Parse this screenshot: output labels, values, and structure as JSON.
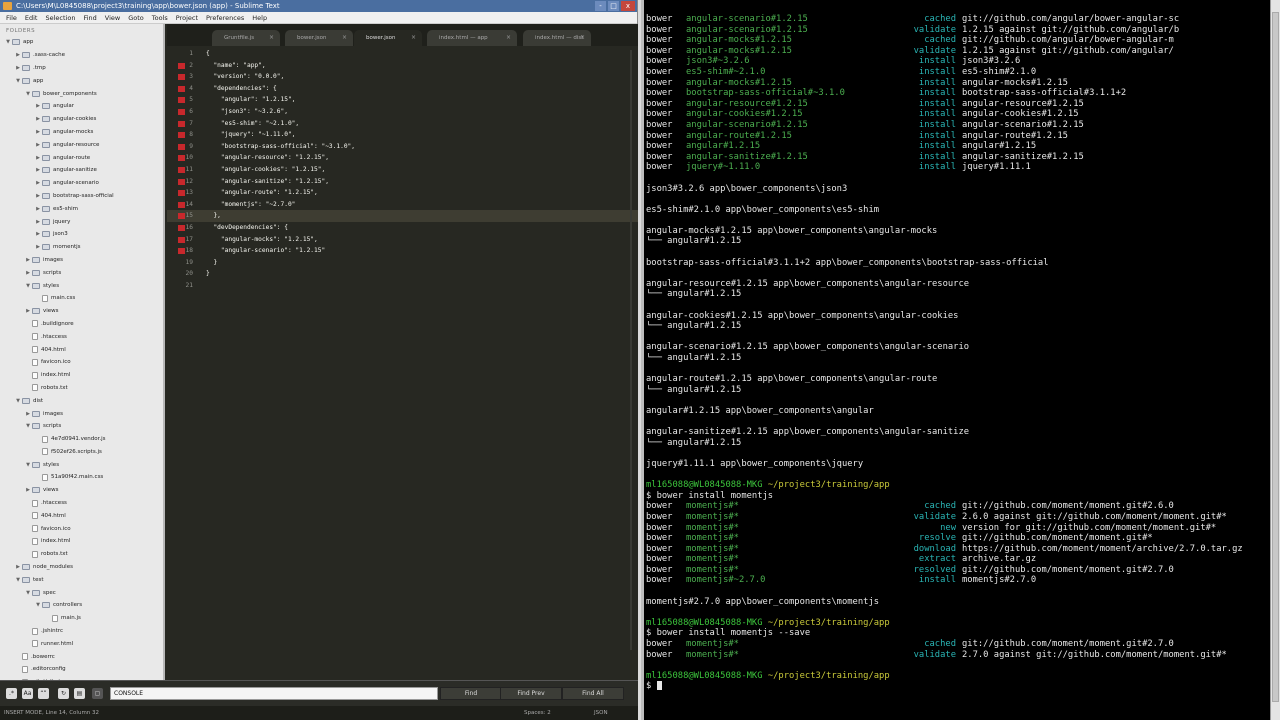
{
  "sublime": {
    "title": "C:\\Users\\M\\L0845088\\project3\\training\\app\\bower.json (app) - Sublime Text",
    "window_controls": [
      "-",
      "□",
      "x"
    ],
    "menu": [
      "File",
      "Edit",
      "Selection",
      "Find",
      "View",
      "Goto",
      "Tools",
      "Project",
      "Preferences",
      "Help"
    ],
    "sidebar_header": "FOLDERS",
    "tree": [
      {
        "label": "app",
        "depth": 0,
        "kind": "folder",
        "open": true
      },
      {
        "label": ".sass-cache",
        "depth": 1,
        "kind": "folder",
        "open": false
      },
      {
        "label": ".tmp",
        "depth": 1,
        "kind": "folder",
        "open": false
      },
      {
        "label": "app",
        "depth": 1,
        "kind": "folder",
        "open": true
      },
      {
        "label": "bower_components",
        "depth": 2,
        "kind": "folder",
        "open": true
      },
      {
        "label": "angular",
        "depth": 3,
        "kind": "folder",
        "open": false
      },
      {
        "label": "angular-cookies",
        "depth": 3,
        "kind": "folder",
        "open": false
      },
      {
        "label": "angular-mocks",
        "depth": 3,
        "kind": "folder",
        "open": false
      },
      {
        "label": "angular-resource",
        "depth": 3,
        "kind": "folder",
        "open": false
      },
      {
        "label": "angular-route",
        "depth": 3,
        "kind": "folder",
        "open": false
      },
      {
        "label": "angular-sanitize",
        "depth": 3,
        "kind": "folder",
        "open": false
      },
      {
        "label": "angular-scenario",
        "depth": 3,
        "kind": "folder",
        "open": false
      },
      {
        "label": "bootstrap-sass-official",
        "depth": 3,
        "kind": "folder",
        "open": false
      },
      {
        "label": "es5-shim",
        "depth": 3,
        "kind": "folder",
        "open": false
      },
      {
        "label": "jquery",
        "depth": 3,
        "kind": "folder",
        "open": false
      },
      {
        "label": "json3",
        "depth": 3,
        "kind": "folder",
        "open": false
      },
      {
        "label": "momentjs",
        "depth": 3,
        "kind": "folder",
        "open": false
      },
      {
        "label": "images",
        "depth": 2,
        "kind": "folder",
        "open": false
      },
      {
        "label": "scripts",
        "depth": 2,
        "kind": "folder",
        "open": false
      },
      {
        "label": "styles",
        "depth": 2,
        "kind": "folder",
        "open": true
      },
      {
        "label": "main.css",
        "depth": 3,
        "kind": "file"
      },
      {
        "label": "views",
        "depth": 2,
        "kind": "folder",
        "open": false
      },
      {
        "label": ".buildignore",
        "depth": 2,
        "kind": "file"
      },
      {
        "label": ".htaccess",
        "depth": 2,
        "kind": "file"
      },
      {
        "label": "404.html",
        "depth": 2,
        "kind": "file"
      },
      {
        "label": "favicon.ico",
        "depth": 2,
        "kind": "file"
      },
      {
        "label": "index.html",
        "depth": 2,
        "kind": "file"
      },
      {
        "label": "robots.txt",
        "depth": 2,
        "kind": "file"
      },
      {
        "label": "dist",
        "depth": 1,
        "kind": "folder",
        "open": true
      },
      {
        "label": "images",
        "depth": 2,
        "kind": "folder",
        "open": false
      },
      {
        "label": "scripts",
        "depth": 2,
        "kind": "folder",
        "open": true
      },
      {
        "label": "4e7d0941.vendor.js",
        "depth": 3,
        "kind": "file"
      },
      {
        "label": "f502ef26.scripts.js",
        "depth": 3,
        "kind": "file"
      },
      {
        "label": "styles",
        "depth": 2,
        "kind": "folder",
        "open": true
      },
      {
        "label": "51a90f42.main.css",
        "depth": 3,
        "kind": "file"
      },
      {
        "label": "views",
        "depth": 2,
        "kind": "folder",
        "open": false
      },
      {
        "label": ".htaccess",
        "depth": 2,
        "kind": "file"
      },
      {
        "label": "404.html",
        "depth": 2,
        "kind": "file"
      },
      {
        "label": "favicon.ico",
        "depth": 2,
        "kind": "file"
      },
      {
        "label": "index.html",
        "depth": 2,
        "kind": "file"
      },
      {
        "label": "robots.txt",
        "depth": 2,
        "kind": "file"
      },
      {
        "label": "node_modules",
        "depth": 1,
        "kind": "folder",
        "open": false
      },
      {
        "label": "test",
        "depth": 1,
        "kind": "folder",
        "open": true
      },
      {
        "label": "spec",
        "depth": 2,
        "kind": "folder",
        "open": true
      },
      {
        "label": "controllers",
        "depth": 3,
        "kind": "folder",
        "open": true
      },
      {
        "label": "main.js",
        "depth": 4,
        "kind": "file"
      },
      {
        "label": ".jshintrc",
        "depth": 2,
        "kind": "file"
      },
      {
        "label": "runner.html",
        "depth": 2,
        "kind": "file"
      },
      {
        "label": ".bowerrc",
        "depth": 1,
        "kind": "file"
      },
      {
        "label": ".editorconfig",
        "depth": 1,
        "kind": "file"
      },
      {
        "label": ".gitattributes",
        "depth": 1,
        "kind": "file"
      }
    ],
    "tabs": [
      {
        "label": "Gruntfile.js",
        "active": false
      },
      {
        "label": "bower.json",
        "active": false
      },
      {
        "label": "bower.json",
        "active": true
      },
      {
        "label": "index.html — app",
        "active": false
      },
      {
        "label": "index.html — dist",
        "active": false
      }
    ],
    "tab_close_glyph": "×",
    "code_lines": [
      {
        "n": "1",
        "t": "{",
        "mark": false
      },
      {
        "n": "2",
        "t": "  \"name\": \"app\",",
        "mark": true
      },
      {
        "n": "3",
        "t": "  \"version\": \"0.0.0\",",
        "mark": true
      },
      {
        "n": "4",
        "t": "  \"dependencies\": {",
        "mark": true
      },
      {
        "n": "5",
        "t": "    \"angular\": \"1.2.15\",",
        "mark": true
      },
      {
        "n": "6",
        "t": "    \"json3\": \"~3.2.6\",",
        "mark": true
      },
      {
        "n": "7",
        "t": "    \"es5-shim\": \"~2.1.0\",",
        "mark": true
      },
      {
        "n": "8",
        "t": "    \"jquery\": \"~1.11.0\",",
        "mark": true
      },
      {
        "n": "9",
        "t": "    \"bootstrap-sass-official\": \"~3.1.0\",",
        "mark": true
      },
      {
        "n": "10",
        "t": "    \"angular-resource\": \"1.2.15\",",
        "mark": true
      },
      {
        "n": "11",
        "t": "    \"angular-cookies\": \"1.2.15\",",
        "mark": true
      },
      {
        "n": "12",
        "t": "    \"angular-sanitize\": \"1.2.15\",",
        "mark": true
      },
      {
        "n": "13",
        "t": "    \"angular-route\": \"1.2.15\",",
        "mark": true
      },
      {
        "n": "14",
        "t": "    \"momentjs\": \"~2.7.0\"",
        "mark": true
      },
      {
        "n": "15",
        "t": "  },",
        "mark": true,
        "current": true
      },
      {
        "n": "16",
        "t": "  \"devDependencies\": {",
        "mark": true
      },
      {
        "n": "17",
        "t": "    \"angular-mocks\": \"1.2.15\",",
        "mark": true
      },
      {
        "n": "18",
        "t": "    \"angular-scenario\": \"1.2.15\"",
        "mark": true
      },
      {
        "n": "19",
        "t": "  }",
        "mark": false
      },
      {
        "n": "20",
        "t": "}",
        "mark": false
      },
      {
        "n": "21",
        "t": "",
        "mark": false
      }
    ],
    "findbar": {
      "input_value": "CONSOLE",
      "find_label": "Find",
      "find_prev_label": "Find Prev",
      "find_all_label": "Find All"
    },
    "status": {
      "mode": "INSERT MODE, Line 14, Column 32",
      "spaces": "Spaces: 2",
      "syntax": "JSON"
    }
  },
  "terminal": {
    "colors": {
      "bg": "#000000",
      "text": "#e8e8e8",
      "green": "#3cc43c",
      "cyan": "#2ab5b5",
      "yellow": "#c9c93a"
    },
    "lines": [
      {
        "type": "bower",
        "pkg": "angular-scenario#1.2.15",
        "action": "cached",
        "msg": "git://github.com/angular/bower-angular-sc"
      },
      {
        "type": "bower",
        "pkg": "angular-scenario#1.2.15",
        "action": "validate",
        "msg": "1.2.15 against git://github.com/angular/b"
      },
      {
        "type": "bower",
        "pkg": "angular-mocks#1.2.15",
        "action": "cached",
        "msg": "git://github.com/angular/bower-angular-m"
      },
      {
        "type": "bower",
        "pkg": "angular-mocks#1.2.15",
        "action": "validate",
        "msg": "1.2.15 against git://github.com/angular/"
      },
      {
        "type": "bower",
        "pkg": "json3#~3.2.6",
        "action": "install",
        "msg": "json3#3.2.6"
      },
      {
        "type": "bower",
        "pkg": "es5-shim#~2.1.0",
        "action": "install",
        "msg": "es5-shim#2.1.0"
      },
      {
        "type": "bower",
        "pkg": "angular-mocks#1.2.15",
        "action": "install",
        "msg": "angular-mocks#1.2.15"
      },
      {
        "type": "bower",
        "pkg": "bootstrap-sass-official#~3.1.0",
        "action": "install",
        "msg": "bootstrap-sass-official#3.1.1+2"
      },
      {
        "type": "bower",
        "pkg": "angular-resource#1.2.15",
        "action": "install",
        "msg": "angular-resource#1.2.15"
      },
      {
        "type": "bower",
        "pkg": "angular-cookies#1.2.15",
        "action": "install",
        "msg": "angular-cookies#1.2.15"
      },
      {
        "type": "bower",
        "pkg": "angular-scenario#1.2.15",
        "action": "install",
        "msg": "angular-scenario#1.2.15"
      },
      {
        "type": "bower",
        "pkg": "angular-route#1.2.15",
        "action": "install",
        "msg": "angular-route#1.2.15"
      },
      {
        "type": "bower",
        "pkg": "angular#1.2.15",
        "action": "install",
        "msg": "angular#1.2.15"
      },
      {
        "type": "bower",
        "pkg": "angular-sanitize#1.2.15",
        "action": "install",
        "msg": "angular-sanitize#1.2.15"
      },
      {
        "type": "bower",
        "pkg": "jquery#~1.11.0",
        "action": "install",
        "msg": "jquery#1.11.1"
      },
      {
        "type": "blank"
      },
      {
        "type": "text",
        "text": "json3#3.2.6 app\\bower_components\\json3"
      },
      {
        "type": "blank"
      },
      {
        "type": "text",
        "text": "es5-shim#2.1.0 app\\bower_components\\es5-shim"
      },
      {
        "type": "blank"
      },
      {
        "type": "text",
        "text": "angular-mocks#1.2.15 app\\bower_components\\angular-mocks"
      },
      {
        "type": "text",
        "text": "└── angular#1.2.15"
      },
      {
        "type": "blank"
      },
      {
        "type": "text",
        "text": "bootstrap-sass-official#3.1.1+2 app\\bower_components\\bootstrap-sass-official"
      },
      {
        "type": "blank"
      },
      {
        "type": "text",
        "text": "angular-resource#1.2.15 app\\bower_components\\angular-resource"
      },
      {
        "type": "text",
        "text": "└── angular#1.2.15"
      },
      {
        "type": "blank"
      },
      {
        "type": "text",
        "text": "angular-cookies#1.2.15 app\\bower_components\\angular-cookies"
      },
      {
        "type": "text",
        "text": "└── angular#1.2.15"
      },
      {
        "type": "blank"
      },
      {
        "type": "text",
        "text": "angular-scenario#1.2.15 app\\bower_components\\angular-scenario"
      },
      {
        "type": "text",
        "text": "└── angular#1.2.15"
      },
      {
        "type": "blank"
      },
      {
        "type": "text",
        "text": "angular-route#1.2.15 app\\bower_components\\angular-route"
      },
      {
        "type": "text",
        "text": "└── angular#1.2.15"
      },
      {
        "type": "blank"
      },
      {
        "type": "text",
        "text": "angular#1.2.15 app\\bower_components\\angular"
      },
      {
        "type": "blank"
      },
      {
        "type": "text",
        "text": "angular-sanitize#1.2.15 app\\bower_components\\angular-sanitize"
      },
      {
        "type": "text",
        "text": "└── angular#1.2.15"
      },
      {
        "type": "blank"
      },
      {
        "type": "text",
        "text": "jquery#1.11.1 app\\bower_components\\jquery"
      },
      {
        "type": "blank"
      },
      {
        "type": "prompt",
        "user": "ml165088@WL0845088-MKG",
        "path": "~/project3/training/app"
      },
      {
        "type": "text",
        "text": "$ bower install momentjs"
      },
      {
        "type": "bower",
        "pkg": "momentjs#*",
        "action": "cached",
        "msg": "git://github.com/moment/moment.git#2.6.0"
      },
      {
        "type": "bower",
        "pkg": "momentjs#*",
        "action": "validate",
        "msg": "2.6.0 against git://github.com/moment/moment.git#*"
      },
      {
        "type": "bower",
        "pkg": "momentjs#*",
        "action": "new",
        "msg": "version for git://github.com/moment/moment.git#*"
      },
      {
        "type": "bower",
        "pkg": "momentjs#*",
        "action": "resolve",
        "msg": "git://github.com/moment/moment.git#*"
      },
      {
        "type": "bower",
        "pkg": "momentjs#*",
        "action": "download",
        "msg": "https://github.com/moment/moment/archive/2.7.0.tar.gz"
      },
      {
        "type": "bower",
        "pkg": "momentjs#*",
        "action": "extract",
        "msg": "archive.tar.gz"
      },
      {
        "type": "bower",
        "pkg": "momentjs#*",
        "action": "resolved",
        "msg": "git://github.com/moment/moment.git#2.7.0"
      },
      {
        "type": "bower",
        "pkg": "momentjs#~2.7.0",
        "action": "install",
        "msg": "momentjs#2.7.0"
      },
      {
        "type": "blank"
      },
      {
        "type": "text",
        "text": "momentjs#2.7.0 app\\bower_components\\momentjs"
      },
      {
        "type": "blank"
      },
      {
        "type": "prompt",
        "user": "ml165088@WL0845088-MKG",
        "path": "~/project3/training/app"
      },
      {
        "type": "text",
        "text": "$ bower install momentjs --save"
      },
      {
        "type": "bower",
        "pkg": "momentjs#*",
        "action": "cached",
        "msg": "git://github.com/moment/moment.git#2.7.0"
      },
      {
        "type": "bower",
        "pkg": "momentjs#*",
        "action": "validate",
        "msg": "2.7.0 against git://github.com/moment/moment.git#*"
      },
      {
        "type": "blank"
      },
      {
        "type": "prompt",
        "user": "ml165088@WL0845088-MKG",
        "path": "~/project3/training/app"
      },
      {
        "type": "cursor",
        "text": "$ "
      }
    ]
  }
}
